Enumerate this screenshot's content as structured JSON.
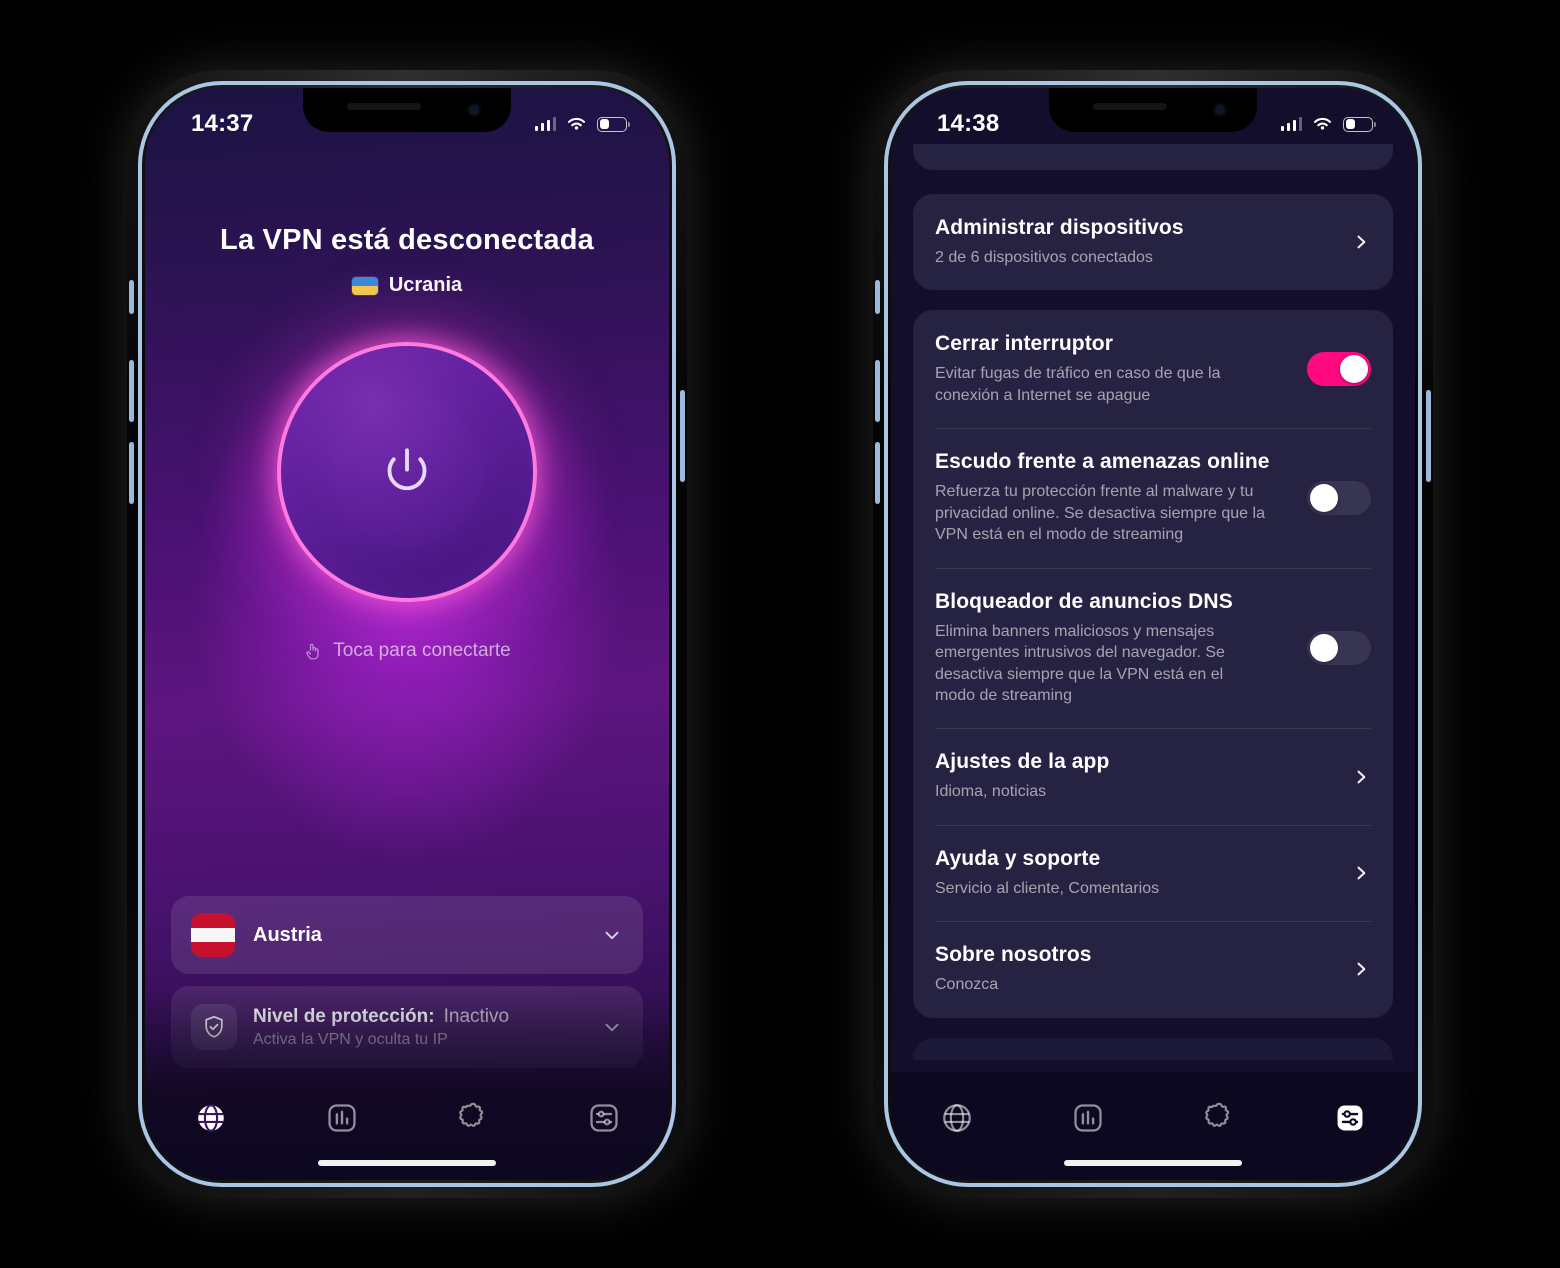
{
  "phone_left": {
    "name": "vpn-home-screen",
    "statusbar": {
      "time": "14:37",
      "signal_icon": "cellular-bars-icon",
      "wifi_icon": "wifi-icon",
      "battery_icon": "battery-icon",
      "battery_level": "36"
    },
    "title": "La VPN está desconectada",
    "location": {
      "country": "Ucrania",
      "flag": "ukraine-flag-icon"
    },
    "power_button": {
      "icon": "power-icon",
      "state": "disconnected"
    },
    "tap_hint": {
      "icon": "tap-hand-icon",
      "label": "Toca para conectarte"
    },
    "country_card": {
      "flag": "austria-flag-icon",
      "name": "Austria",
      "chevron": "chevron-down-icon"
    },
    "protection_card": {
      "icon": "shield-check-icon",
      "label": "Nivel de protección:",
      "value": "Inactivo",
      "desc": "Activa la VPN y oculta tu IP",
      "chevron": "chevron-down-icon"
    },
    "nav": [
      {
        "name": "globe-icon",
        "label": "globe",
        "active": true
      },
      {
        "name": "chart-icon",
        "label": "stats",
        "active": false
      },
      {
        "name": "puzzle-icon",
        "label": "extras",
        "active": false
      },
      {
        "name": "sliders-icon",
        "label": "settings",
        "active": false
      }
    ]
  },
  "phone_right": {
    "name": "vpn-settings-screen",
    "statusbar": {
      "time": "14:38",
      "signal_icon": "cellular-bars-icon",
      "wifi_icon": "wifi-icon",
      "battery_icon": "battery-icon",
      "battery_level": "36"
    },
    "groups": [
      {
        "name": "devices-group",
        "rows": [
          {
            "type": "link",
            "title": "Administrar dispositivos",
            "desc": "2 de 6 dispositivos conectados",
            "chevron": "chevron-right-icon"
          }
        ]
      },
      {
        "name": "protection-group",
        "rows": [
          {
            "type": "toggle",
            "title": "Cerrar interruptor",
            "desc": "Evitar fugas de tráfico en caso de que la conexión a Internet se apague",
            "on": true
          },
          {
            "type": "toggle",
            "title": "Escudo frente a amenazas online",
            "desc": "Refuerza tu protección frente al malware y tu privacidad online. Se desactiva siempre que la VPN está en el modo de streaming",
            "on": false
          },
          {
            "type": "toggle",
            "title": "Bloqueador de anuncios DNS",
            "desc": "Elimina banners maliciosos y mensajes emergentes intrusivos del navegador. Se desactiva siempre que la VPN está en el modo de streaming",
            "on": false
          },
          {
            "type": "link",
            "title": "Ajustes de la app",
            "desc": "Idioma, noticias",
            "chevron": "chevron-right-icon"
          },
          {
            "type": "link",
            "title": "Ayuda y soporte",
            "desc": "Servicio al cliente, Comentarios",
            "chevron": "chevron-right-icon"
          },
          {
            "type": "link",
            "title": "Sobre nosotros",
            "desc": "Conozca",
            "chevron": "chevron-right-icon"
          }
        ]
      }
    ],
    "nav": [
      {
        "name": "globe-icon",
        "label": "globe",
        "active": false
      },
      {
        "name": "chart-icon",
        "label": "stats",
        "active": false
      },
      {
        "name": "puzzle-icon",
        "label": "extras",
        "active": false
      },
      {
        "name": "sliders-icon",
        "label": "settings",
        "active": true
      }
    ]
  },
  "colors": {
    "accent_pink": "#ff0a80",
    "power_ring": "#ff7ae0",
    "card_dark": "#262342",
    "page_dark": "#120e2b",
    "toggle_off": "#383552",
    "bezel": "#a9c6e6"
  }
}
